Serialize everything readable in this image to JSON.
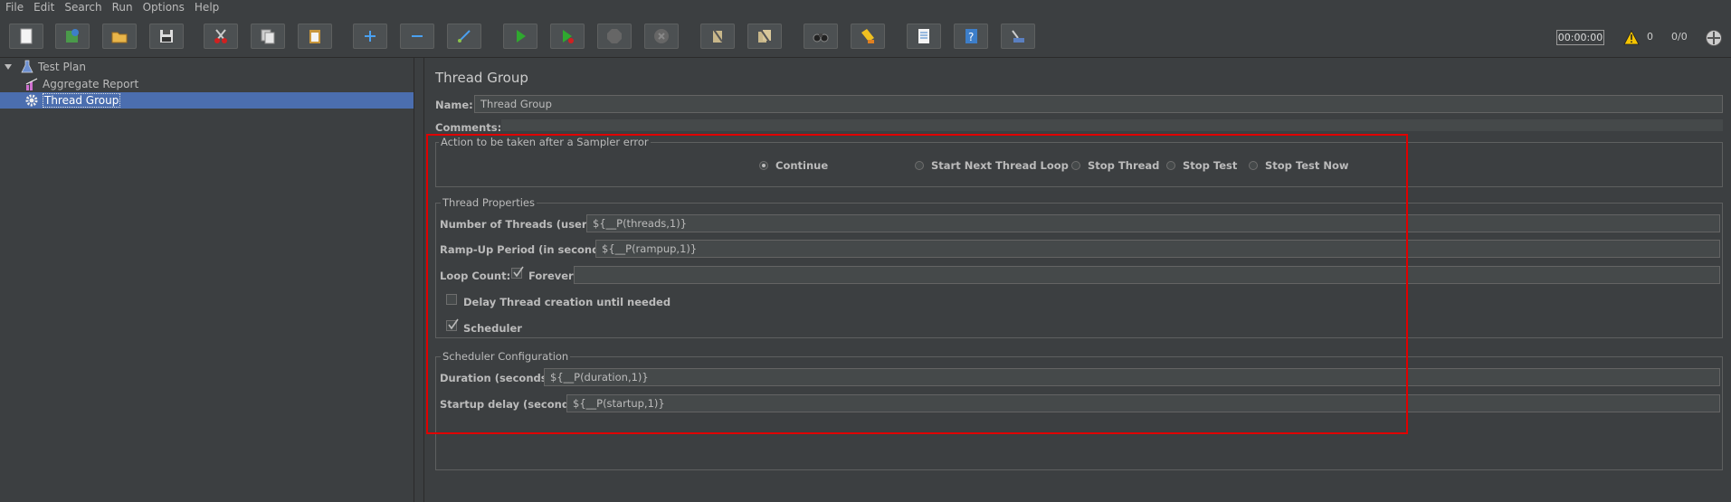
{
  "menu": [
    "File",
    "Edit",
    "Search",
    "Run",
    "Options",
    "Help"
  ],
  "toolbar": {
    "icons": [
      "new-icon",
      "templates-icon",
      "open-icon",
      "save-icon",
      "cut-icon",
      "copy-icon",
      "paste-icon",
      "expand-icon",
      "collapse-icon",
      "toggle-icon",
      "start-icon",
      "start-no-pause-icon",
      "stop-icon",
      "shutdown-icon",
      "clear-icon",
      "clear-all-icon",
      "search-icon",
      "reset-search-icon",
      "function-helper-icon",
      "help-icon",
      "remote-icon"
    ],
    "timer": "00:00:00",
    "warning_count": "0",
    "threads": "0/0"
  },
  "tree": {
    "items": [
      {
        "label": "Test Plan",
        "icon": "test-plan-icon"
      },
      {
        "label": "Aggregate Report",
        "icon": "report-icon"
      },
      {
        "label": "Thread Group",
        "icon": "gear-icon",
        "selected": true
      }
    ]
  },
  "panel": {
    "title": "Thread Group",
    "name_label": "Name:",
    "name_value": "Thread Group",
    "comments_label": "Comments:",
    "sampler_error": {
      "title": "Action to be taken after a Sampler error",
      "options": [
        "Continue",
        "Start Next Thread Loop",
        "Stop Thread",
        "Stop Test",
        "Stop Test Now"
      ],
      "selected": "Continue"
    },
    "thread_properties": {
      "title": "Thread Properties",
      "threads_label": "Number of Threads (users):",
      "threads_value": "${__P(threads,1)}",
      "rampup_label": "Ramp-Up Period (in seconds):",
      "rampup_value": "${__P(rampup,1)}",
      "loop_label": "Loop Count:",
      "forever_label": "Forever",
      "forever_checked": true,
      "delay_label": "Delay Thread creation until needed",
      "delay_checked": false,
      "scheduler_label": "Scheduler",
      "scheduler_checked": true
    },
    "scheduler_config": {
      "title": "Scheduler Configuration",
      "duration_label": "Duration (seconds)",
      "duration_value": "${__P(duration,1)}",
      "startup_label": "Startup delay (seconds)",
      "startup_value": "${__P(startup,1)}"
    }
  },
  "colors": {
    "background": "#3c3f41",
    "selection": "#4b6eaf",
    "highlight_border": "#e00000"
  }
}
